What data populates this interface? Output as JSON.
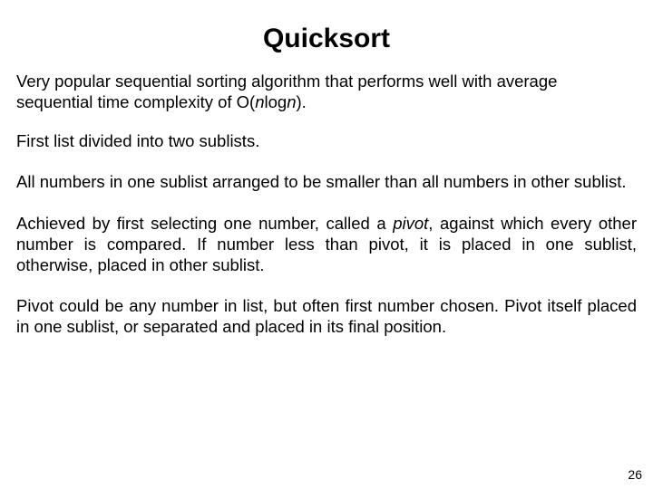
{
  "title": "Quicksort",
  "paragraphs": {
    "p0_a": "Very popular sequential sorting algorithm that performs well with average sequential time complexity of O(",
    "p0_n1": "n",
    "p0_b": "log",
    "p0_n2": "n",
    "p0_c": ").",
    "p1": "First list divided into two sublists.",
    "p2": "All numbers in one sublist arranged to be smaller than all numbers in other sublist.",
    "p3_a": "Achieved by first selecting one number, called a ",
    "p3_pivot": "pivot",
    "p3_b": ", against which every other number is compared. If number less than pivot, it is placed in one sublist,  otherwise, placed in other sublist.",
    "p4": "Pivot could be any number in list, but often first number chosen. Pivot itself placed in one sublist, or separated and placed in its final position."
  },
  "pageNumber": "26"
}
